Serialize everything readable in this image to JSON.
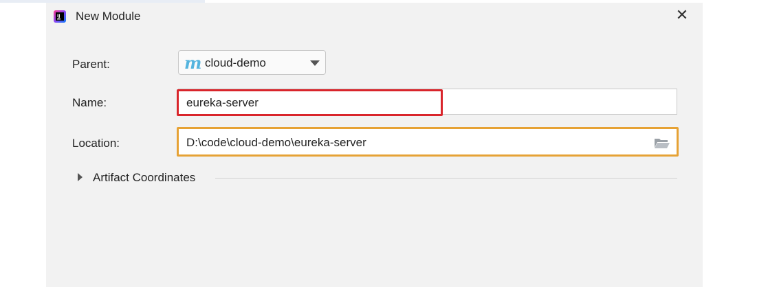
{
  "dialog": {
    "title": "New Module",
    "close_symbol": "✕"
  },
  "form": {
    "parent_label": "Parent:",
    "parent_value": "cloud-demo",
    "parent_icon_glyph": "m",
    "name_label": "Name:",
    "name_value": "eureka-server",
    "location_label": "Location:",
    "location_value": "D:\\code\\cloud-demo\\eureka-server"
  },
  "artifact": {
    "label": "Artifact Coordinates"
  },
  "colors": {
    "dialog_bg": "#f2f2f2",
    "name_highlight": "#d9252b",
    "location_highlight": "#e6a235",
    "maven_icon": "#54b4de"
  },
  "icons": [
    "intellij-app-icon",
    "close-icon",
    "maven-module-icon",
    "dropdown-caret-icon",
    "folder-open-icon",
    "expand-caret-icon"
  ]
}
